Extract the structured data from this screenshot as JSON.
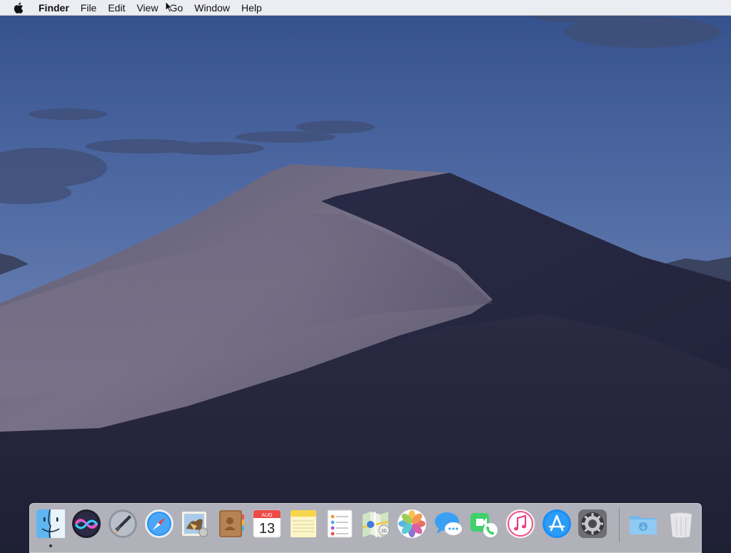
{
  "menubar": {
    "apple_icon": "apple-icon",
    "app_name": "Finder",
    "items": [
      "File",
      "Edit",
      "View",
      "Go",
      "Window",
      "Help"
    ]
  },
  "dock": {
    "apps": [
      {
        "name": "Finder",
        "icon": "finder-icon",
        "running": true
      },
      {
        "name": "Siri",
        "icon": "siri-icon"
      },
      {
        "name": "Launchpad",
        "icon": "launchpad-icon"
      },
      {
        "name": "Safari",
        "icon": "safari-icon"
      },
      {
        "name": "Mail",
        "icon": "mail-icon"
      },
      {
        "name": "Contacts",
        "icon": "contacts-icon"
      },
      {
        "name": "Calendar",
        "icon": "calendar-icon",
        "month": "AUG",
        "day": "13"
      },
      {
        "name": "Notes",
        "icon": "notes-icon"
      },
      {
        "name": "Reminders",
        "icon": "reminders-icon"
      },
      {
        "name": "Maps",
        "icon": "maps-icon"
      },
      {
        "name": "Photos",
        "icon": "photos-icon"
      },
      {
        "name": "Messages",
        "icon": "messages-icon"
      },
      {
        "name": "FaceTime",
        "icon": "facetime-icon"
      },
      {
        "name": "iTunes",
        "icon": "itunes-icon"
      },
      {
        "name": "App Store",
        "icon": "app-store-icon"
      },
      {
        "name": "System Preferences",
        "icon": "system-preferences-icon"
      }
    ],
    "folders": [
      {
        "name": "Downloads",
        "icon": "downloads-folder-icon"
      },
      {
        "name": "Trash",
        "icon": "trash-icon"
      }
    ]
  },
  "colors": {
    "sky_top": "#3b5591",
    "sky_mid": "#5a74a8",
    "dune_light": "#6e6a80",
    "dune_shadow": "#24253e",
    "dock_bg": "#d6d6dc"
  }
}
